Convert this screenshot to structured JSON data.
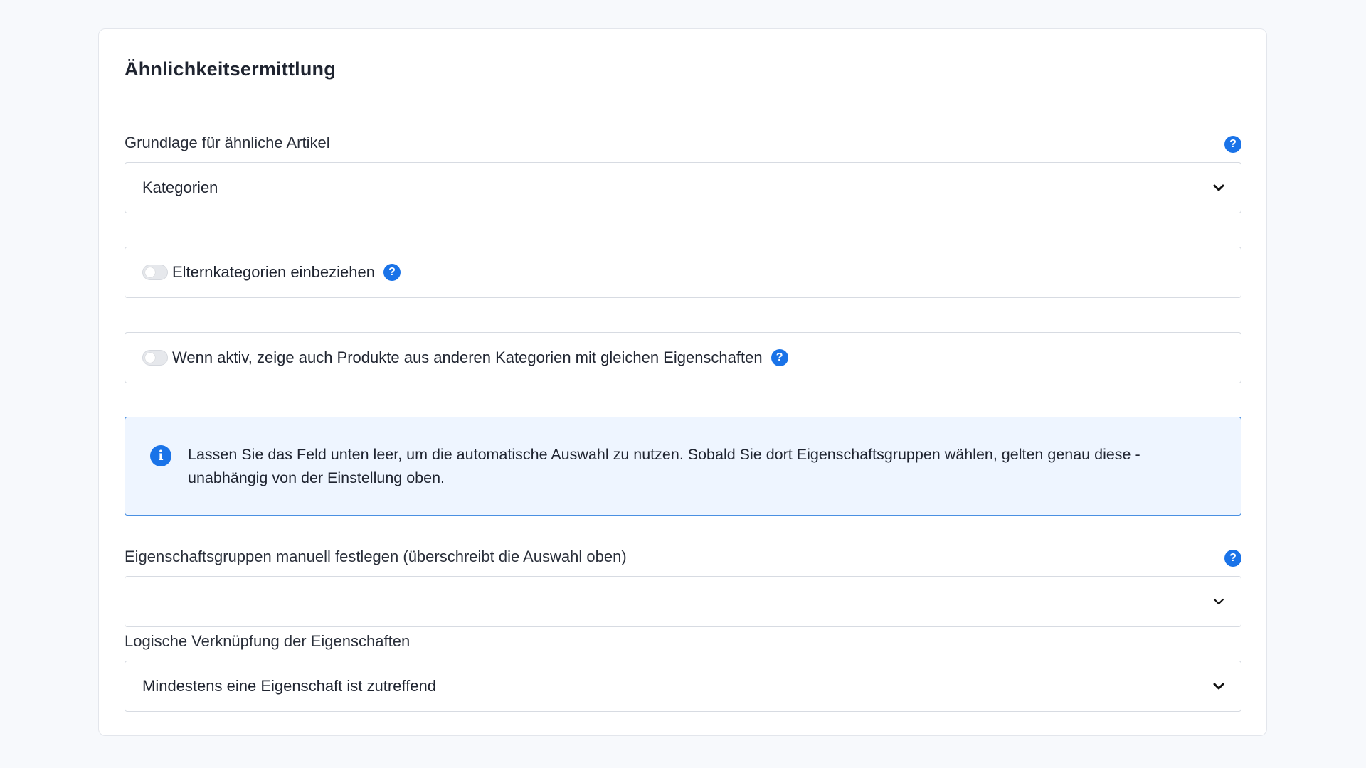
{
  "section": {
    "title": "Ähnlichkeitsermittlung"
  },
  "basis": {
    "label": "Grundlage für ähnliche Artikel",
    "value": "Kategorien",
    "help": "?"
  },
  "parent_categories": {
    "label": "Elternkategorien einbeziehen",
    "enabled": false,
    "help": "?"
  },
  "other_categories": {
    "label": "Wenn aktiv, zeige auch Produkte aus anderen Kategorien mit gleichen Eigenschaften",
    "enabled": false,
    "help": "?"
  },
  "info": {
    "icon": "i",
    "text": "Lassen Sie das Feld unten leer, um die automatische Auswahl zu nutzen. Sobald Sie dort Eigenschaftsgruppen wählen, gelten genau diese - unabhängig von der Einstellung oben."
  },
  "property_groups": {
    "label": "Eigenschaftsgruppen manuell festlegen (überschreibt die Auswahl oben)",
    "value": "",
    "help": "?"
  },
  "logic": {
    "label": "Logische Verknüpfung der Eigenschaften",
    "value": "Mindestens eine Eigenschaft ist zutreffend"
  },
  "colors": {
    "accent": "#1a73e8",
    "info_background": "#eef5ff",
    "info_border": "#4a90e2",
    "page_background": "#f7f9fc"
  },
  "icons": {
    "help": "question-mark-icon",
    "info": "info-icon",
    "dropdown": "chevron-down-icon"
  }
}
